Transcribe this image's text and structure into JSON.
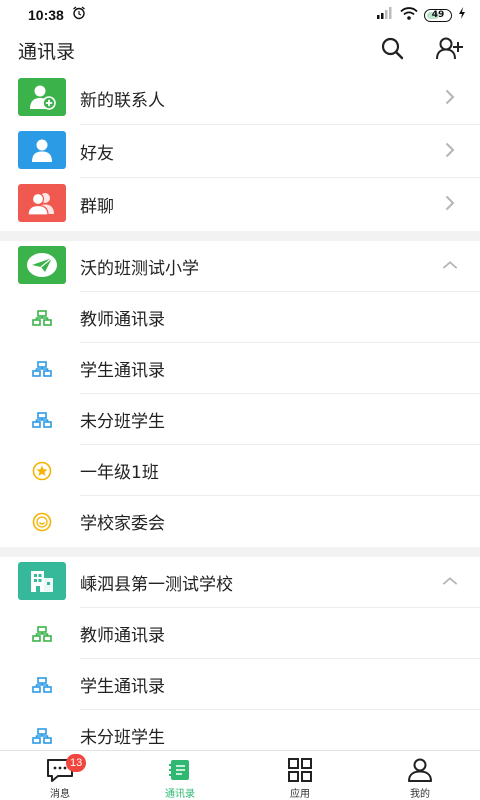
{
  "status_bar": {
    "time": "10:38",
    "battery": "49"
  },
  "header": {
    "title": "通讯录"
  },
  "top_items": [
    {
      "label": "新的联系人",
      "icon": "add-person-icon",
      "color": "#3cb34a"
    },
    {
      "label": "好友",
      "icon": "person-icon",
      "color": "#2c9be5"
    },
    {
      "label": "群聊",
      "icon": "group-icon",
      "color": "#f0594f"
    }
  ],
  "school1": {
    "name": "沃的班测试小学",
    "icon": "paper-plane-icon",
    "color": "#3cb34a",
    "items": [
      {
        "label": "教师通讯录",
        "icon": "org-chart-icon",
        "color": "#3cb34a"
      },
      {
        "label": "学生通讯录",
        "icon": "org-chart-icon",
        "color": "#2c9be5"
      },
      {
        "label": "未分班学生",
        "icon": "org-chart-icon",
        "color": "#2c9be5"
      },
      {
        "label": "一年级1班",
        "icon": "star-icon",
        "color": "#f5b400"
      },
      {
        "label": "学校家委会",
        "icon": "smile-icon",
        "color": "#f5b400"
      }
    ]
  },
  "school2": {
    "name": "嵊泗县第一测试学校",
    "icon": "building-icon",
    "color": "#35b99a",
    "items": [
      {
        "label": "教师通讯录",
        "icon": "org-chart-icon",
        "color": "#3cb34a"
      },
      {
        "label": "学生通讯录",
        "icon": "org-chart-icon",
        "color": "#2c9be5"
      },
      {
        "label": "未分班学生",
        "icon": "org-chart-icon",
        "color": "#2c9be5"
      }
    ]
  },
  "tabs": [
    {
      "label": "消息",
      "icon": "chat-icon",
      "badge": "13"
    },
    {
      "label": "通讯录",
      "icon": "contacts-book-icon",
      "active": true
    },
    {
      "label": "应用",
      "icon": "grid-icon"
    },
    {
      "label": "我的",
      "icon": "profile-icon"
    }
  ],
  "colors": {
    "accent": "#2eb872",
    "badge": "#f2453d"
  }
}
